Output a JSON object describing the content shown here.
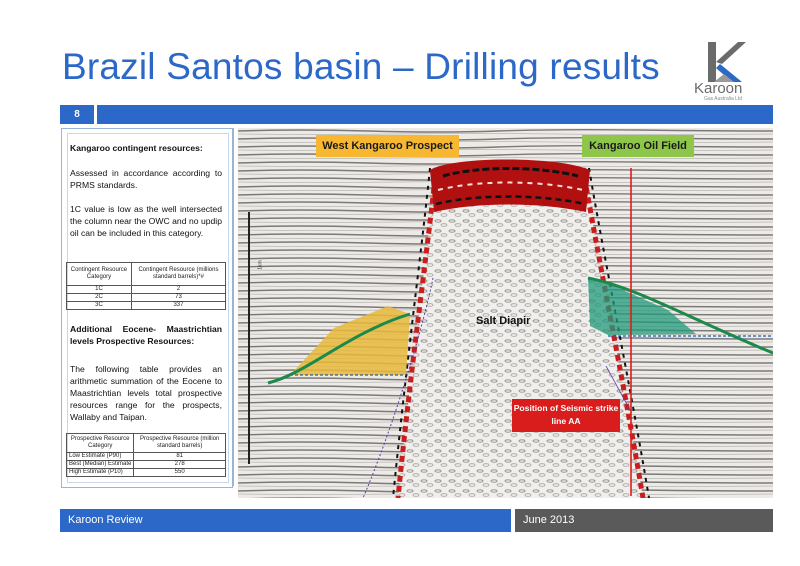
{
  "title": "Brazil Santos basin – Drilling results",
  "page_number": "8",
  "logo": {
    "name": "Karoon",
    "subtitle": "Gas Australia Ltd"
  },
  "left_panel": {
    "heading1": "Kangaroo contingent resources:",
    "para1": "Assessed in accordance according to PRMS standards.",
    "para2": "1C value is low as the well intersected the column near the OWC and no updip oil can be included in this category.",
    "table1": {
      "headers": [
        "Contingent Resource Category",
        "Contingent Resource (millions standard barrels)*#"
      ],
      "rows": [
        [
          "1C",
          "2"
        ],
        [
          "2C",
          "73"
        ],
        [
          "3C",
          "337"
        ]
      ]
    },
    "heading2": "Additional Eocene- Maastrichtian levels Prospective Resources:",
    "para3": "The following table provides an arithmetic summation of the Eocene to Maastrichtian levels total prospective resources range for the prospects, Wallaby and Taipan.",
    "table2": {
      "headers": [
        "Prospective Resource Category",
        "Prospective Resource (million standard barrels)"
      ],
      "rows": [
        [
          "Low Estimate (P90)",
          "81"
        ],
        [
          "Best (Median) Estimate",
          "278"
        ],
        [
          "High Estimate (P10)",
          "550"
        ]
      ]
    }
  },
  "seismic": {
    "label_west": "West Kangaroo Prospect",
    "label_field": "Kangaroo Oil Field",
    "label_salt": "Salt Diapir",
    "label_position": "Position of Seismic strike line AA",
    "scale_label": "1km",
    "colors": {
      "west": "#f7b731",
      "field": "#8ec64a",
      "position": "#d91c1c"
    }
  },
  "footer": {
    "left": "Karoon Review",
    "right": "June 2013"
  },
  "colors": {
    "accent": "#2b68c8",
    "footer_dark": "#5a5a5a"
  }
}
